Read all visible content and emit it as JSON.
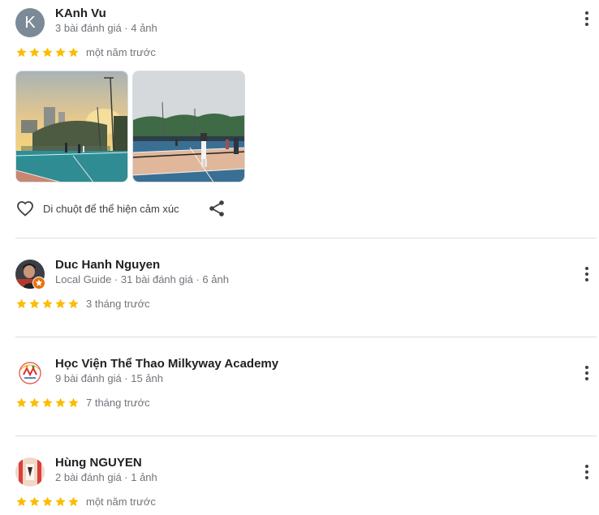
{
  "reviews": [
    {
      "name": "KAnh Vu",
      "avatar_letter": "K",
      "meta": "3 bài đánh giá · 4 ảnh",
      "stars": 5,
      "time": "một năm trước",
      "reaction_label": "Di chuột để thể hiện cảm xúc"
    },
    {
      "name": "Duc Hanh Nguyen",
      "meta": "Local Guide · 31 bài đánh giá · 6 ảnh",
      "stars": 5,
      "time": "3 tháng trước"
    },
    {
      "name": "Học Viện Thể Thao Milkyway Academy",
      "meta": "9 bài đánh giá · 15 ảnh",
      "stars": 5,
      "time": "7 tháng trước"
    },
    {
      "name": "Hùng NGUYEN",
      "meta": "2 bài đánh giá · 1 ảnh",
      "stars": 5,
      "time": "một năm trước"
    }
  ],
  "colors": {
    "star": "#fbbc04",
    "text_primary": "#202124",
    "text_secondary": "#70757a",
    "divider": "#dadce0",
    "avatar_letter_bg": "#7c8a97",
    "local_guide_badge": "#e8710a"
  },
  "icons": [
    "more-vert-icon",
    "heart-icon",
    "share-icon",
    "star-icon",
    "local-guide-badge-icon"
  ]
}
